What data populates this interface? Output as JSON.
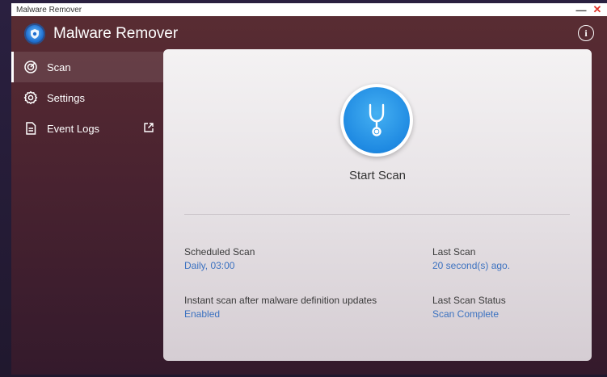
{
  "window": {
    "title": "Malware Remover",
    "minimize_label": "—",
    "close_label": "✕"
  },
  "header": {
    "app_name": "Malware Remover",
    "info_label": "i"
  },
  "sidebar": {
    "items": [
      {
        "label": "Scan",
        "icon": "scan-icon",
        "active": true
      },
      {
        "label": "Settings",
        "icon": "gear-icon",
        "active": false
      },
      {
        "label": "Event Logs",
        "icon": "document-icon",
        "active": false,
        "external": "external-link-icon"
      }
    ]
  },
  "main": {
    "start_scan_label": "Start Scan",
    "scheduled_scan": {
      "label": "Scheduled Scan",
      "value": "Daily, 03:00"
    },
    "last_scan": {
      "label": "Last Scan",
      "value": "20 second(s) ago."
    },
    "instant_scan": {
      "label": "Instant scan after malware definition updates",
      "value": "Enabled"
    },
    "last_scan_status": {
      "label": "Last Scan Status",
      "value": "Scan Complete"
    }
  },
  "colors": {
    "accent_blue": "#1f8ae2",
    "value_blue": "#3c72c0",
    "close_red": "#e0342a"
  }
}
